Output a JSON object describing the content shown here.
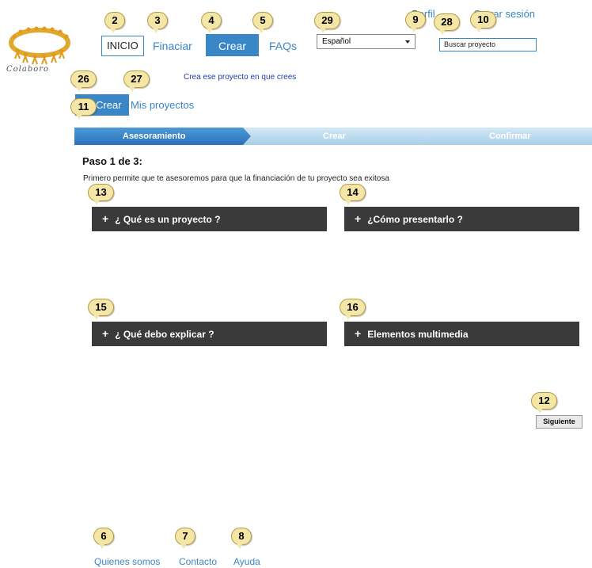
{
  "brand": {
    "logo_text": "Colaboro"
  },
  "nav": {
    "inicio": "INICIO",
    "financiar": "Finaciar",
    "crear": "Crear",
    "faqs": "FAQs"
  },
  "language": {
    "selected": "Español"
  },
  "account": {
    "perfil": "Perfil",
    "cerrar_sesion": "Cerrar sesión"
  },
  "search": {
    "value": "Buscar proyecto"
  },
  "slogan": "Crea ese proyecto en que crees",
  "subnav": {
    "crear": "Crear",
    "mis_proyectos": "Mis proyectos"
  },
  "steps": {
    "items": [
      "Asesoramiento",
      "Crear",
      "Confirmar"
    ],
    "active_index": 0
  },
  "paso": {
    "title": "Paso 1 de 3:",
    "description": "Primero permite que te asesoremos para que la financiación de tu proyecto sea exitosa"
  },
  "accordions": [
    {
      "plus": "+",
      "label": "¿ Qué es un proyecto ?"
    },
    {
      "plus": "+",
      "label": "¿Cómo presentarlo ?"
    },
    {
      "plus": "+",
      "label": "¿ Qué debo explicar ?"
    },
    {
      "plus": "+",
      "label": "Elementos multimedia"
    }
  ],
  "siguiente": "Siguiente",
  "footer": {
    "quienes": "Quienes somos",
    "contacto": "Contacto",
    "ayuda": "Ayuda"
  },
  "callouts": {
    "c2": "2",
    "c3": "3",
    "c4": "4",
    "c5": "5",
    "c29": "29",
    "c9": "9",
    "c28": "28",
    "c10": "10",
    "c26": "26",
    "c27": "27",
    "c11": "11",
    "c13": "13",
    "c14": "14",
    "c15": "15",
    "c16": "16",
    "c12": "12",
    "c6": "6",
    "c7": "7",
    "c8": "8"
  },
  "colors": {
    "accent": "#3a87c8",
    "dark_panel": "#3a3a3a",
    "callout": "#f3e6a6",
    "step_inactive": "#b9d9ee"
  }
}
